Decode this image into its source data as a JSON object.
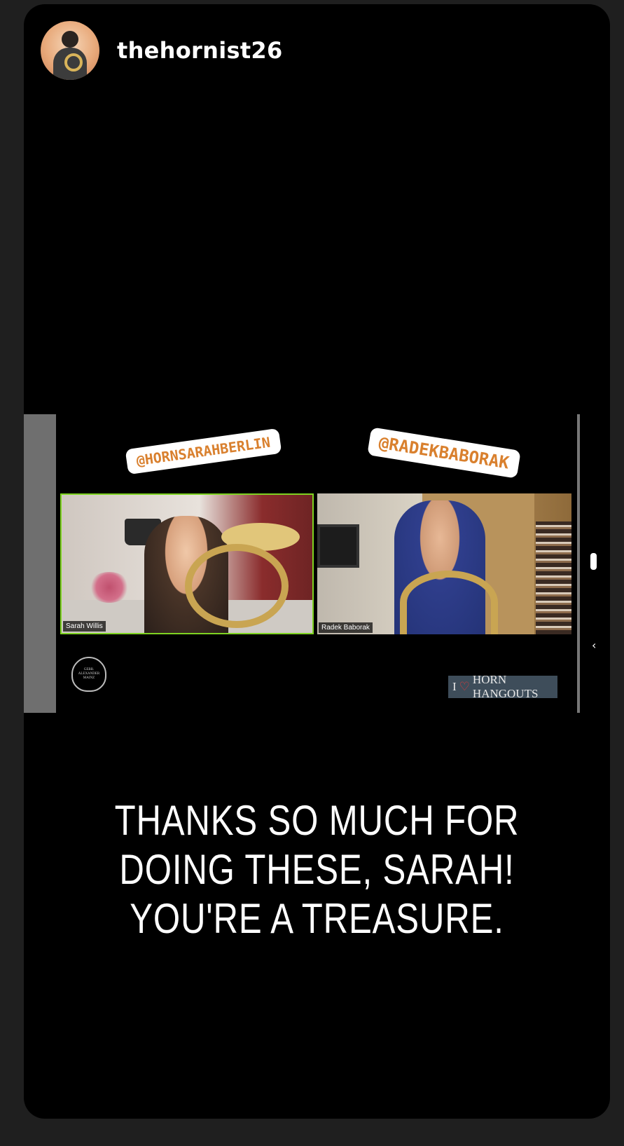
{
  "story": {
    "username": "thehornist26",
    "avatar_icon": "profile-avatar",
    "caption": "THANKS SO MUCH FOR DOING THESE, SARAH! YOU'RE A TREASURE."
  },
  "video": {
    "stickers": [
      "@HORNSARAHBERLIN",
      "@RADEKBABORAK"
    ],
    "participants": [
      "Sarah Willis",
      "Radek Baborak"
    ],
    "active_border_color": "#7ed321",
    "seal_text": "GEBR. ALEXANDER MAINZ",
    "hangouts_logo": {
      "prefix": "I",
      "icon": "heart-icon",
      "text": "HORN HANGOUTS"
    }
  },
  "side_controls": {
    "chevron": "‹"
  }
}
